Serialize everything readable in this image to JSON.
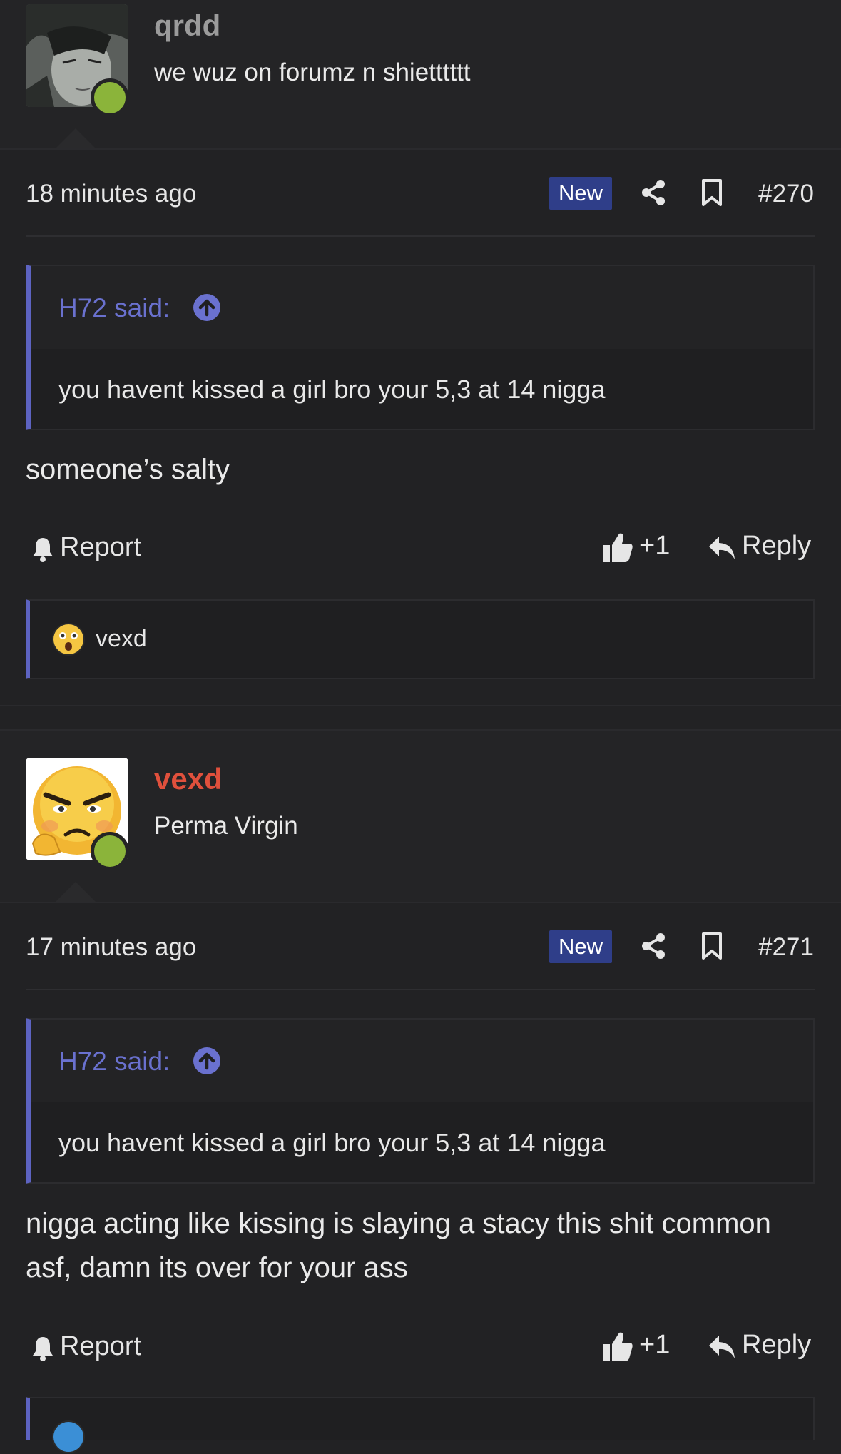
{
  "posts": [
    {
      "username": "qrdd",
      "user_title": "we wuz on forumz n shietttttt",
      "username_color": "#9b9b9b",
      "time": "18 minutes ago",
      "badge": "New",
      "number": "#270",
      "quote_author": "H72 said:",
      "quote_text": "you havent kissed a girl bro your 5,3 at 14 nigga",
      "body": "someone’s salty",
      "report_label": "Report",
      "like_count": "+1",
      "reply_label": "Reply",
      "reaction_user": "vexd"
    },
    {
      "username": "vexd",
      "user_title": "Perma Virgin",
      "username_color": "#e0503c",
      "time": "17 minutes ago",
      "badge": "New",
      "number": "#271",
      "quote_author": "H72 said:",
      "quote_text": "you havent kissed a girl bro your 5,3 at 14 nigga",
      "body": "nigga acting like kissing is slaying a stacy this shit common asf, damn its over for your ass",
      "report_label": "Report",
      "like_count": "+1",
      "reply_label": "Reply"
    }
  ],
  "colors": {
    "accent": "#5d63c1",
    "badge_bg": "#2f3e89",
    "online": "#8bb43a"
  }
}
